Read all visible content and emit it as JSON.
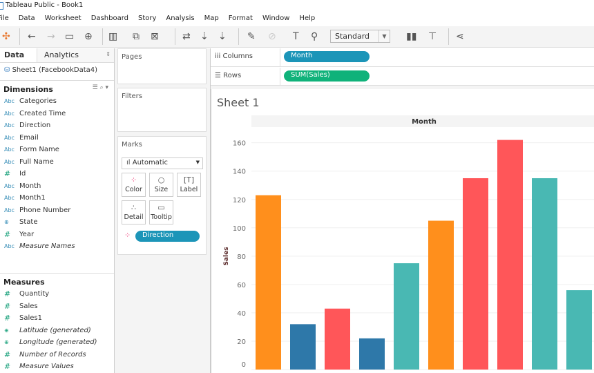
{
  "window": {
    "title": "Tableau Public - Book1"
  },
  "menu": [
    "File",
    "Data",
    "Worksheet",
    "Dashboard",
    "Story",
    "Analysis",
    "Map",
    "Format",
    "Window",
    "Help"
  ],
  "toolbar": {
    "fit": "Standard"
  },
  "left": {
    "tabs": {
      "data": "Data",
      "analytics": "Analytics"
    },
    "source": "Sheet1 (FacebookData4)",
    "dimensions_title": "Dimensions",
    "dimensions": [
      {
        "icon": "Abc",
        "label": "Categories"
      },
      {
        "icon": "Abc",
        "label": "Created Time"
      },
      {
        "icon": "Abc",
        "label": "Direction"
      },
      {
        "icon": "Abc",
        "label": "Email"
      },
      {
        "icon": "Abc",
        "label": "Form Name"
      },
      {
        "icon": "Abc",
        "label": "Full Name"
      },
      {
        "icon": "#",
        "label": "Id"
      },
      {
        "icon": "Abc",
        "label": "Month"
      },
      {
        "icon": "Abc",
        "label": "Month1"
      },
      {
        "icon": "Abc",
        "label": "Phone Number"
      },
      {
        "icon": "globe",
        "label": "State"
      },
      {
        "icon": "#",
        "label": "Year"
      },
      {
        "icon": "Abc",
        "label": "Measure Names"
      }
    ],
    "measures_title": "Measures",
    "measures": [
      {
        "icon": "#",
        "label": "Quantity"
      },
      {
        "icon": "#",
        "label": "Sales"
      },
      {
        "icon": "#",
        "label": "Sales1"
      },
      {
        "icon": "globe",
        "label": "Latitude (generated)"
      },
      {
        "icon": "globe",
        "label": "Longitude (generated)"
      },
      {
        "icon": "#",
        "label": "Number of Records"
      },
      {
        "icon": "#",
        "label": "Measure Values"
      }
    ]
  },
  "shelves": {
    "pages": "Pages",
    "filters": "Filters",
    "marks": "Marks",
    "mark_type": "Automatic",
    "buttons": {
      "color": "Color",
      "size": "Size",
      "label": "Label",
      "detail": "Detail",
      "tooltip": "Tooltip"
    },
    "color_pill": "Direction",
    "columns_label": "Columns",
    "columns_pill": "Month",
    "rows_label": "Rows",
    "rows_pill": "SUM(Sales)"
  },
  "colors": {
    "dimension_pill": "#1C95B8",
    "measure_pill": "#10B27A"
  },
  "sheet": {
    "title": "Sheet 1"
  },
  "chart_data": {
    "type": "bar",
    "header": "Month",
    "ylabel": "Sales",
    "ylim": [
      0,
      170
    ],
    "yticks": [
      0,
      20,
      40,
      60,
      80,
      100,
      120,
      140,
      160
    ],
    "grid": true,
    "values": [
      123,
      32,
      43,
      22,
      75,
      105,
      135,
      162,
      135,
      56
    ],
    "colors": [
      "#FF8F1C",
      "#2E78A9",
      "#FF5659",
      "#2E78A9",
      "#49B8B3",
      "#FF8F1C",
      "#FF5659",
      "#FF5659",
      "#49B8B3",
      "#49B8B3"
    ]
  }
}
